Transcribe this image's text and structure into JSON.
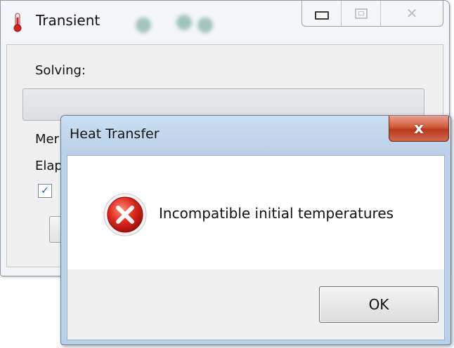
{
  "background_window": {
    "title": "Transient",
    "icon": "thermometer-icon",
    "controls": [
      "minimize-icon",
      "maximize-icon",
      "close-icon"
    ],
    "solving_label": "Solving:",
    "progress": 0,
    "lines": [
      "Mer",
      "Elap"
    ],
    "checkbox_checked": true
  },
  "dialog": {
    "title": "Heat Transfer",
    "close_glyph": "x",
    "icon": "error-icon",
    "message": "Incompatible initial temperatures",
    "ok_label": "OK"
  },
  "colors": {
    "error_red": "#d32020",
    "close_button_red": "#c8472a",
    "dialog_frame": "#b9d0e8",
    "checkbox_check": "#2355b5"
  }
}
